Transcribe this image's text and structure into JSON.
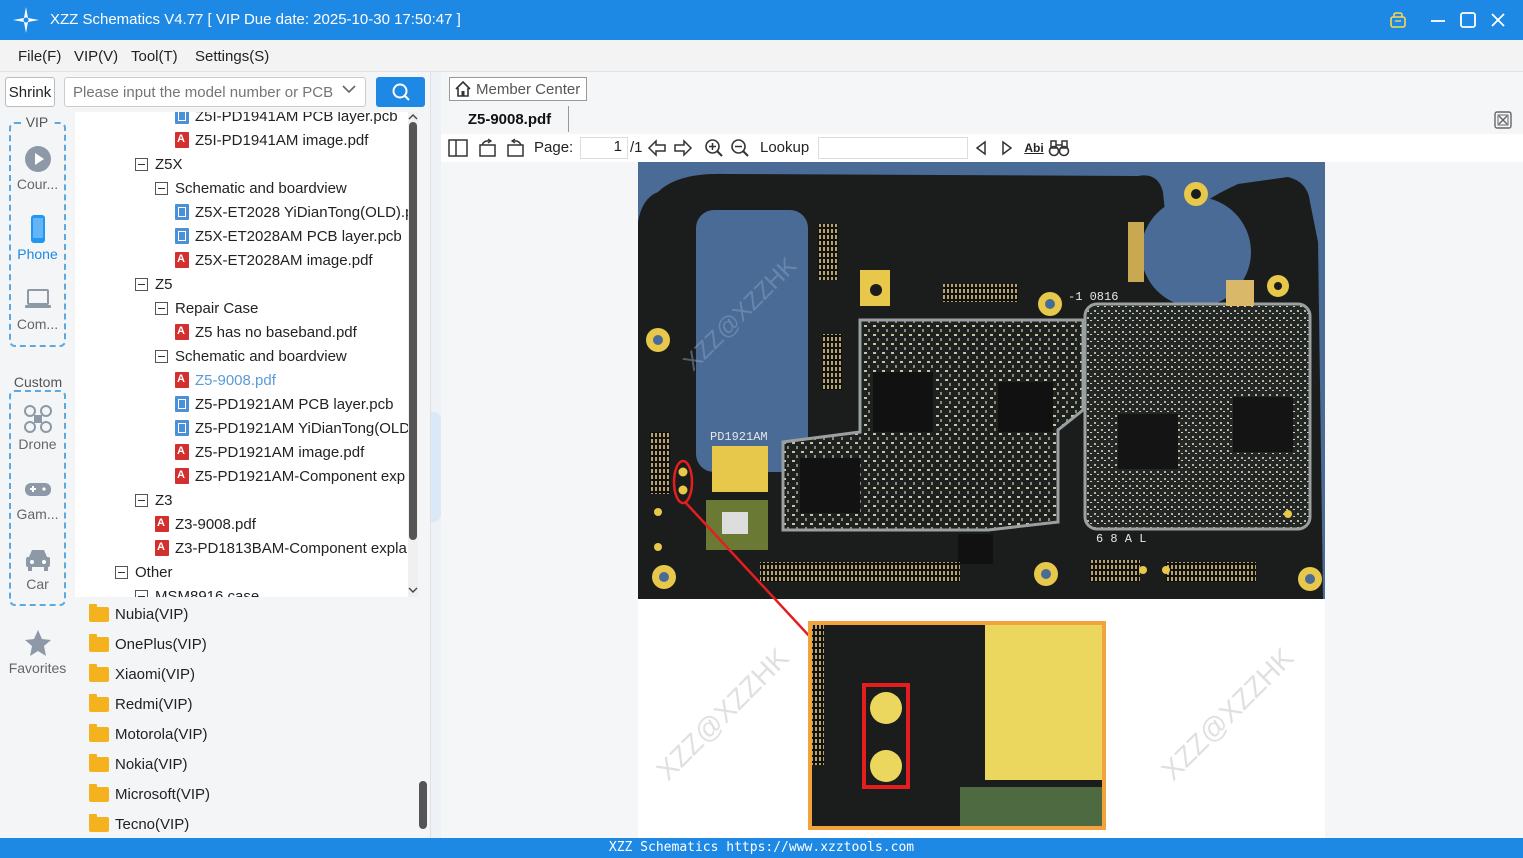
{
  "titlebar": {
    "title": "XZZ Schematics V4.77 [ VIP Due date: 2025-10-30 17:50:47 ]"
  },
  "menu": [
    {
      "label": "File(F)"
    },
    {
      "label": "VIP(V)"
    },
    {
      "label": "Tool(T)"
    },
    {
      "label": "Settings(S)"
    }
  ],
  "rail": {
    "shrink_label": "Shrink",
    "vip_label": "VIP",
    "custom_label": "Custom",
    "vip_items": [
      {
        "label": "Cour...",
        "icon": "play-circle-icon"
      },
      {
        "label": "Phone",
        "icon": "phone-icon",
        "active": true
      },
      {
        "label": "Com...",
        "icon": "laptop-icon"
      }
    ],
    "custom_items": [
      {
        "label": "Drone",
        "icon": "drone-icon"
      },
      {
        "label": "Gam...",
        "icon": "gamepad-icon"
      },
      {
        "label": "Car",
        "icon": "car-icon"
      }
    ],
    "favorites_label": "Favorites"
  },
  "search": {
    "placeholder": "Please input the model number or PCB"
  },
  "tree": [
    {
      "label": "Z5I-PD1941AM PCB layer.pcb",
      "type": "pcb"
    },
    {
      "label": "Z5I-PD1941AM image.pdf",
      "type": "pdf"
    },
    {
      "label": "Z5X",
      "type": "group"
    },
    {
      "label": "Schematic and boardview",
      "type": "group"
    },
    {
      "label": "Z5X-ET2028 YiDianTong(OLD).p",
      "type": "pcb"
    },
    {
      "label": "Z5X-ET2028AM PCB layer.pcb",
      "type": "pcb"
    },
    {
      "label": "Z5X-ET2028AM image.pdf",
      "type": "pdf"
    },
    {
      "label": "Z5",
      "type": "group"
    },
    {
      "label": "Repair Case",
      "type": "group"
    },
    {
      "label": "Z5 has no baseband.pdf",
      "type": "pdf"
    },
    {
      "label": "Schematic and boardview",
      "type": "group"
    },
    {
      "label": "Z5-9008.pdf",
      "type": "pdf",
      "selected": true
    },
    {
      "label": "Z5-PD1921AM PCB layer.pcb",
      "type": "pcb"
    },
    {
      "label": "Z5-PD1921AM YiDianTong(OLD",
      "type": "pcb"
    },
    {
      "label": "Z5-PD1921AM image.pdf",
      "type": "pdf"
    },
    {
      "label": "Z5-PD1921AM-Component exp",
      "type": "pdf"
    },
    {
      "label": "Z3",
      "type": "group"
    },
    {
      "label": "Z3-9008.pdf",
      "type": "pdf"
    },
    {
      "label": "Z3-PD1813BAM-Component expla",
      "type": "pdf"
    },
    {
      "label": "Other",
      "type": "group"
    },
    {
      "label": "MSM8916 case",
      "type": "group"
    }
  ],
  "folders": [
    {
      "label": "Nubia(VIP)"
    },
    {
      "label": "OnePlus(VIP)"
    },
    {
      "label": "Xiaomi(VIP)"
    },
    {
      "label": "Redmi(VIP)"
    },
    {
      "label": "Motorola(VIP)"
    },
    {
      "label": "Nokia(VIP)"
    },
    {
      "label": "Microsoft(VIP)"
    },
    {
      "label": "Tecno(VIP)"
    }
  ],
  "viewer": {
    "member_center": "Member Center",
    "tab_label": "Z5-9008.pdf",
    "page_label": "Page:",
    "page_current": "1",
    "page_total": "/1",
    "lookup_label": "Lookup",
    "abi_label": "Abi"
  },
  "board": {
    "silkscreen_model": "PD1921AM",
    "silkscreen_code": "-1  0816",
    "silkscreen_pins": "6 8 A   L",
    "watermark": "XZZ@XZZHK"
  },
  "status": {
    "text": "XZZ Schematics https://www.xzztools.com"
  },
  "colors": {
    "accent": "#1e88e5",
    "pcb": "#1a1d1c",
    "gold": "#e8c84a",
    "highlight": "#e41e1e",
    "zoom_border": "#f3a33c"
  }
}
